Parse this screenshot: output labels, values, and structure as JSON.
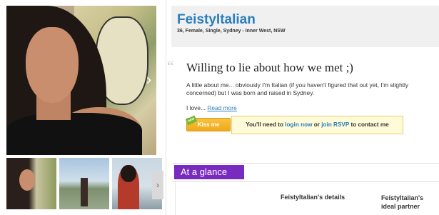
{
  "profile": {
    "username": "FeistyItalian",
    "details": "36, Female, Single, Sydney - Inner West, NSW"
  },
  "photos": {
    "next_icon": "chevron-right-icon",
    "thumbnail_count": 3,
    "thumb_scroll_icon": "chevron-right-icon"
  },
  "about": {
    "headline": "Willing to lie about how we met ;)",
    "intro": "A little about me... obviously I'm Italian (if you haven't figured that out yet, I'm slightly concerned) but I was born and raised in Sydney.",
    "love_prefix": "I love...",
    "read_more": "Read more"
  },
  "actions": {
    "kiss_label": "Kiss me",
    "kiss_badge": "new",
    "rsvp_prefix": "You'll need to",
    "login_link": "login now",
    "rsvp_or": "or",
    "join_link": "join RSVP",
    "rsvp_suffix": "to contact me"
  },
  "glance": {
    "tab_label": "At a glance",
    "details_heading": "FeistyItalian's details",
    "ideal_heading": "FeistyItalian's ideal partner"
  },
  "colors": {
    "accent_blue": "#2b7ebb",
    "tab_purple": "#7a2bbf",
    "kiss_orange": "#f0a91a"
  }
}
